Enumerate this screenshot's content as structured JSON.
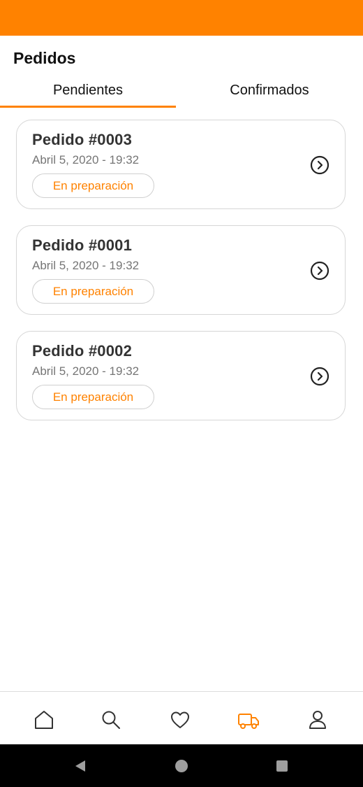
{
  "header": {
    "title": "Pedidos"
  },
  "tabs": [
    {
      "label": "Pendientes",
      "active": true
    },
    {
      "label": "Confirmados",
      "active": false
    }
  ],
  "orders": [
    {
      "title": "Pedido #0003",
      "date": "Abril 5, 2020 - 19:32",
      "status": "En preparación"
    },
    {
      "title": "Pedido #0001",
      "date": "Abril 5, 2020 - 19:32",
      "status": "En preparación"
    },
    {
      "title": "Pedido #0002",
      "date": "Abril 5, 2020 - 19:32",
      "status": "En preparación"
    }
  ],
  "bottom_nav": [
    {
      "icon": "home-icon",
      "active": false
    },
    {
      "icon": "search-icon",
      "active": false
    },
    {
      "icon": "heart-icon",
      "active": false
    },
    {
      "icon": "truck-icon",
      "active": true
    },
    {
      "icon": "user-icon",
      "active": false
    }
  ],
  "system_nav": {
    "icons": [
      "back-icon",
      "home-circle-icon",
      "recents-icon"
    ]
  },
  "colors": {
    "accent": "#ff8200",
    "text_dark": "#333333",
    "text_muted": "#757575",
    "border": "#d6d6d6"
  }
}
